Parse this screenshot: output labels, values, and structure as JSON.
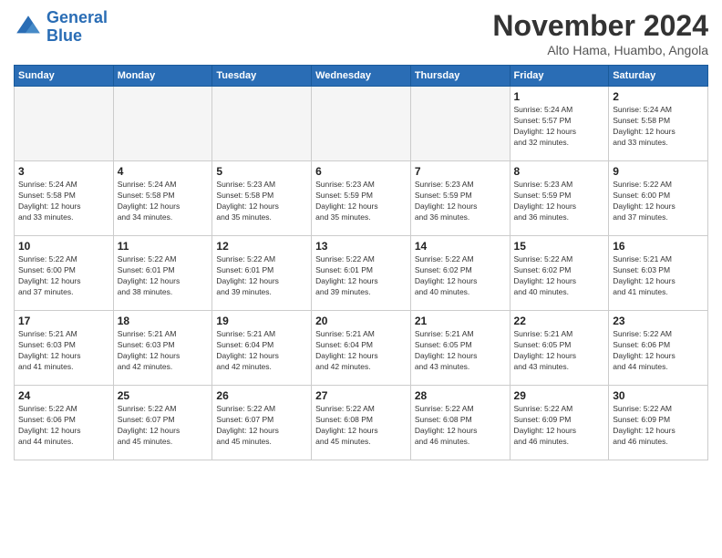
{
  "logo": {
    "line1": "General",
    "line2": "Blue"
  },
  "title": "November 2024",
  "location": "Alto Hama, Huambo, Angola",
  "days_of_week": [
    "Sunday",
    "Monday",
    "Tuesday",
    "Wednesday",
    "Thursday",
    "Friday",
    "Saturday"
  ],
  "weeks": [
    [
      {
        "num": "",
        "info": ""
      },
      {
        "num": "",
        "info": ""
      },
      {
        "num": "",
        "info": ""
      },
      {
        "num": "",
        "info": ""
      },
      {
        "num": "",
        "info": ""
      },
      {
        "num": "1",
        "info": "Sunrise: 5:24 AM\nSunset: 5:57 PM\nDaylight: 12 hours\nand 32 minutes."
      },
      {
        "num": "2",
        "info": "Sunrise: 5:24 AM\nSunset: 5:58 PM\nDaylight: 12 hours\nand 33 minutes."
      }
    ],
    [
      {
        "num": "3",
        "info": "Sunrise: 5:24 AM\nSunset: 5:58 PM\nDaylight: 12 hours\nand 33 minutes."
      },
      {
        "num": "4",
        "info": "Sunrise: 5:24 AM\nSunset: 5:58 PM\nDaylight: 12 hours\nand 34 minutes."
      },
      {
        "num": "5",
        "info": "Sunrise: 5:23 AM\nSunset: 5:58 PM\nDaylight: 12 hours\nand 35 minutes."
      },
      {
        "num": "6",
        "info": "Sunrise: 5:23 AM\nSunset: 5:59 PM\nDaylight: 12 hours\nand 35 minutes."
      },
      {
        "num": "7",
        "info": "Sunrise: 5:23 AM\nSunset: 5:59 PM\nDaylight: 12 hours\nand 36 minutes."
      },
      {
        "num": "8",
        "info": "Sunrise: 5:23 AM\nSunset: 5:59 PM\nDaylight: 12 hours\nand 36 minutes."
      },
      {
        "num": "9",
        "info": "Sunrise: 5:22 AM\nSunset: 6:00 PM\nDaylight: 12 hours\nand 37 minutes."
      }
    ],
    [
      {
        "num": "10",
        "info": "Sunrise: 5:22 AM\nSunset: 6:00 PM\nDaylight: 12 hours\nand 37 minutes."
      },
      {
        "num": "11",
        "info": "Sunrise: 5:22 AM\nSunset: 6:01 PM\nDaylight: 12 hours\nand 38 minutes."
      },
      {
        "num": "12",
        "info": "Sunrise: 5:22 AM\nSunset: 6:01 PM\nDaylight: 12 hours\nand 39 minutes."
      },
      {
        "num": "13",
        "info": "Sunrise: 5:22 AM\nSunset: 6:01 PM\nDaylight: 12 hours\nand 39 minutes."
      },
      {
        "num": "14",
        "info": "Sunrise: 5:22 AM\nSunset: 6:02 PM\nDaylight: 12 hours\nand 40 minutes."
      },
      {
        "num": "15",
        "info": "Sunrise: 5:22 AM\nSunset: 6:02 PM\nDaylight: 12 hours\nand 40 minutes."
      },
      {
        "num": "16",
        "info": "Sunrise: 5:21 AM\nSunset: 6:03 PM\nDaylight: 12 hours\nand 41 minutes."
      }
    ],
    [
      {
        "num": "17",
        "info": "Sunrise: 5:21 AM\nSunset: 6:03 PM\nDaylight: 12 hours\nand 41 minutes."
      },
      {
        "num": "18",
        "info": "Sunrise: 5:21 AM\nSunset: 6:03 PM\nDaylight: 12 hours\nand 42 minutes."
      },
      {
        "num": "19",
        "info": "Sunrise: 5:21 AM\nSunset: 6:04 PM\nDaylight: 12 hours\nand 42 minutes."
      },
      {
        "num": "20",
        "info": "Sunrise: 5:21 AM\nSunset: 6:04 PM\nDaylight: 12 hours\nand 42 minutes."
      },
      {
        "num": "21",
        "info": "Sunrise: 5:21 AM\nSunset: 6:05 PM\nDaylight: 12 hours\nand 43 minutes."
      },
      {
        "num": "22",
        "info": "Sunrise: 5:21 AM\nSunset: 6:05 PM\nDaylight: 12 hours\nand 43 minutes."
      },
      {
        "num": "23",
        "info": "Sunrise: 5:22 AM\nSunset: 6:06 PM\nDaylight: 12 hours\nand 44 minutes."
      }
    ],
    [
      {
        "num": "24",
        "info": "Sunrise: 5:22 AM\nSunset: 6:06 PM\nDaylight: 12 hours\nand 44 minutes."
      },
      {
        "num": "25",
        "info": "Sunrise: 5:22 AM\nSunset: 6:07 PM\nDaylight: 12 hours\nand 45 minutes."
      },
      {
        "num": "26",
        "info": "Sunrise: 5:22 AM\nSunset: 6:07 PM\nDaylight: 12 hours\nand 45 minutes."
      },
      {
        "num": "27",
        "info": "Sunrise: 5:22 AM\nSunset: 6:08 PM\nDaylight: 12 hours\nand 45 minutes."
      },
      {
        "num": "28",
        "info": "Sunrise: 5:22 AM\nSunset: 6:08 PM\nDaylight: 12 hours\nand 46 minutes."
      },
      {
        "num": "29",
        "info": "Sunrise: 5:22 AM\nSunset: 6:09 PM\nDaylight: 12 hours\nand 46 minutes."
      },
      {
        "num": "30",
        "info": "Sunrise: 5:22 AM\nSunset: 6:09 PM\nDaylight: 12 hours\nand 46 minutes."
      }
    ]
  ]
}
